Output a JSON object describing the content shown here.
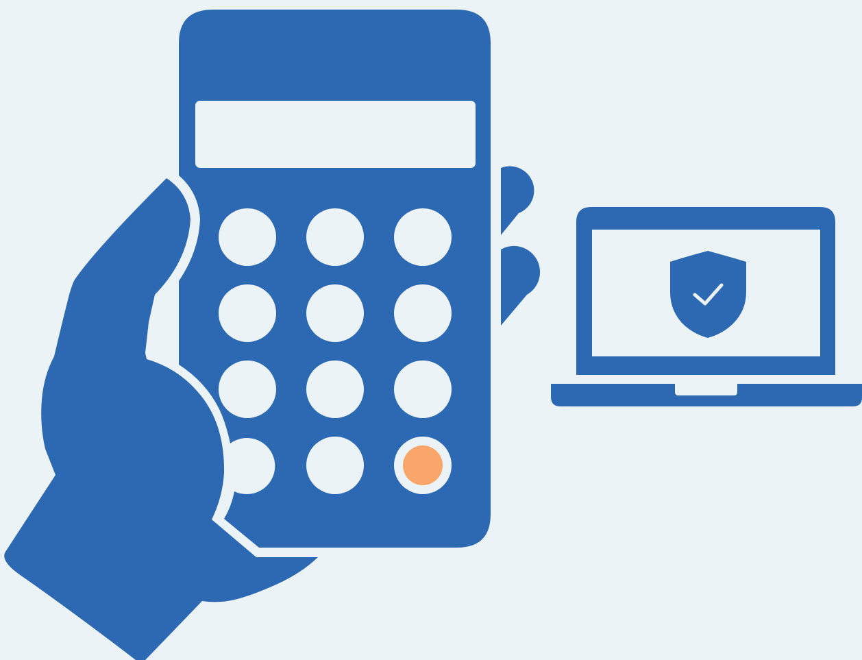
{
  "illustration": {
    "colors": {
      "background": "#EBF3F7",
      "primary": "#2D68B2",
      "accent": "#F8A66A",
      "light": "#EBF3F7"
    },
    "hand": {
      "icon": "hand-icon"
    },
    "token_device": {
      "icon": "hardware-token-icon",
      "keypad": {
        "rows": 4,
        "cols": 3,
        "highlighted_key": "row-4-col-3"
      }
    },
    "signal": {
      "icon": "signal-waves-icon"
    },
    "laptop": {
      "icon": "laptop-icon",
      "screen_icon": "shield-check-icon"
    }
  }
}
